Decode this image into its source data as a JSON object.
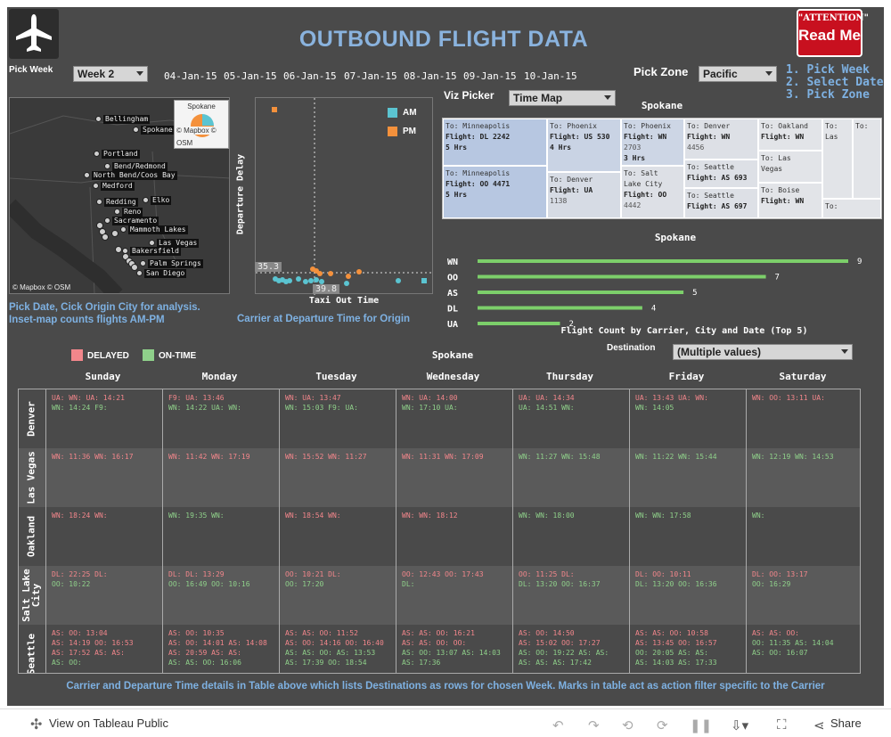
{
  "header": {
    "title": "OUTBOUND FLIGHT DATA",
    "readme_top": "\"ATTENTION\"",
    "readme_main": "Read Me"
  },
  "controls": {
    "pick_week_label": "Pick Week",
    "week_value": "Week 2",
    "dates": [
      "04-Jan-15",
      "05-Jan-15",
      "06-Jan-15",
      "07-Jan-15",
      "08-Jan-15",
      "09-Jan-15",
      "10-Jan-15"
    ],
    "pick_zone_label": "Pick Zone",
    "zone_value": "Pacific",
    "steps": [
      "1. Pick Week",
      "2. Select Date",
      "3. Pick Zone"
    ],
    "viz_picker_label": "Viz Picker",
    "viz_value": "Time Map",
    "destination_label": "Destination",
    "destination_value": "(Multiple values)"
  },
  "map": {
    "cities": [
      "Bellingham",
      "Spokane",
      "Portland",
      "Bend/Redmond",
      "North Bend/Coos Bay",
      "Medford",
      "Redding",
      "Elko",
      "Reno",
      "Sacramento",
      "Mammoth Lakes",
      "Las Vegas",
      "Bakersfield",
      "Palm Springs",
      "San Diego"
    ],
    "copyright": "© Mapbox  © OSM",
    "inset_title": "Spokane",
    "inset_copyright_1": "© Mapbox  ©",
    "inset_copyright_2": "OSM",
    "caption_1": "Pick Date, Cick Origin City for analysis.",
    "caption_2": "Inset-map counts flights  AM-PM"
  },
  "scatter": {
    "legend": [
      {
        "name": "AM",
        "color": "#5bc4d1"
      },
      {
        "name": "PM",
        "color": "#f4913c"
      }
    ],
    "ylabel": "Departure Delay",
    "xlabel": "Taxi Out Time",
    "ref_y": "35.3",
    "ref_x": "39.8",
    "caption": "Carrier at Departure Time for Origin"
  },
  "timemap": {
    "title": "Spokane",
    "cells": [
      {
        "to": "To: Minneapolis",
        "flight": "Flight: DL 2242",
        "dur": "5 Hrs"
      },
      {
        "to": "To: Minneapolis",
        "flight": "Flight: OO 4471",
        "dur": "5 Hrs"
      },
      {
        "to": "To: Phoenix",
        "flight": "Flight: US 530",
        "dur": "4 Hrs"
      },
      {
        "to": "To: Denver",
        "flight": "Flight: UA",
        "extra": "1138"
      },
      {
        "to": "To: Phoenix",
        "flight": "Flight: WN",
        "extra": "2703",
        "dur": "3 Hrs"
      },
      {
        "to": "To: Salt",
        "flight": "Lake City",
        "extra": "Flight: OO",
        "extra2": "4442"
      },
      {
        "to": "To: Denver",
        "flight": "Flight: WN",
        "extra": "4456"
      },
      {
        "to": "To: Seattle",
        "flight": "Flight: AS 693"
      },
      {
        "to": "To: Seattle",
        "flight": "Flight: AS 697"
      },
      {
        "to": "To: Oakland",
        "flight": "Flight: WN"
      },
      {
        "to": "To: Las",
        "flight": "Vegas"
      },
      {
        "to": "To: Boise",
        "flight": "Flight: WN"
      },
      {
        "to": "To:",
        "flight": "Las"
      },
      {
        "to": "To:"
      },
      {
        "to": "To:"
      }
    ]
  },
  "carrier_bar": {
    "title": "Spokane",
    "caption": "Flight Count by Carrier, City and Date (Top 5)"
  },
  "chart_data": {
    "type": "bar",
    "orientation": "horizontal",
    "title": "Spokane",
    "xlabel": "Flight Count by Carrier, City and Date (Top 5)",
    "categories": [
      "WN",
      "OO",
      "AS",
      "DL",
      "UA"
    ],
    "values": [
      9,
      7,
      5,
      4,
      2
    ],
    "color": "#7ccf6a"
  },
  "calendar": {
    "title": "Spokane",
    "legend_delayed": "DELAYED",
    "legend_ontime": "ON-TIME",
    "days": [
      "Sunday",
      "Monday",
      "Tuesday",
      "Wednesday",
      "Thursday",
      "Friday",
      "Saturday"
    ],
    "rows": [
      {
        "city": "Denver",
        "cells": [
          [
            [
              "dl",
              "UA: WN: UA: 14:21"
            ],
            [
              "ot",
              "WN: 14:24 F9:"
            ]
          ],
          [
            [
              "dl",
              "F9: UA: 13:46"
            ],
            [
              "ot",
              "WN: 14:22 UA: WN:"
            ]
          ],
          [
            [
              "dl",
              "WN: UA: 13:47"
            ],
            [
              "ot",
              "WN: 15:03 F9: UA:"
            ]
          ],
          [
            [
              "dl",
              "WN: UA: 14:00"
            ],
            [
              "ot",
              "WN: 17:10 UA:"
            ]
          ],
          [
            [
              "dl",
              "UA: UA: 14:34"
            ],
            [
              "ot",
              "UA: 14:51 WN:"
            ]
          ],
          [
            [
              "dl",
              "UA: 13:43 UA: WN:"
            ],
            [
              "ot",
              "WN: 14:05"
            ]
          ],
          [
            [
              "dl",
              "WN: OO: 13:11 UA:"
            ]
          ]
        ]
      },
      {
        "city": "Las Vegas",
        "cells": [
          [
            [
              "dl",
              "WN: 11:36 WN: 16:17"
            ]
          ],
          [
            [
              "dl",
              "WN: 11:42 WN: 17:19"
            ]
          ],
          [
            [
              "dl",
              "WN: 15:52 WN: 11:27"
            ]
          ],
          [
            [
              "dl",
              "WN: 11:31 WN: 17:09"
            ]
          ],
          [
            [
              "ot",
              "WN: 11:27 WN: 15:48"
            ]
          ],
          [
            [
              "ot",
              "WN: 11:22 WN: 15:44"
            ]
          ],
          [
            [
              "ot",
              "WN: 12:19 WN: 14:53"
            ]
          ]
        ]
      },
      {
        "city": "Oakland",
        "cells": [
          [
            [
              "dl",
              "WN: 18:24 WN:"
            ]
          ],
          [
            [
              "ot",
              "WN: 19:35 WN:"
            ]
          ],
          [
            [
              "dl",
              "WN: 18:54 WN:"
            ]
          ],
          [
            [
              "dl",
              "WN: WN: 18:12"
            ]
          ],
          [
            [
              "ot",
              "WN: WN: 18:00"
            ]
          ],
          [
            [
              "ot",
              "WN: WN: 17:58"
            ]
          ],
          [
            [
              "ot",
              "WN:"
            ]
          ]
        ]
      },
      {
        "city": "Salt Lake City",
        "cells": [
          [
            [
              "dl",
              "DL: 22:25 DL:"
            ],
            [
              "ot",
              "OO: 10:22"
            ]
          ],
          [
            [
              "dl",
              "DL: DL: 13:29"
            ],
            [
              "ot",
              "OO: 16:49 OO: 10:16"
            ]
          ],
          [
            [
              "dl",
              "OO: 10:21 DL:"
            ],
            [
              "ot",
              "OO: 17:20"
            ]
          ],
          [
            [
              "dl",
              "OO: 12:43 OO: 17:43"
            ],
            [
              "ot",
              "DL:"
            ]
          ],
          [
            [
              "dl",
              "OO: 11:25 DL:"
            ],
            [
              "ot",
              "DL: 13:20 OO: 16:37"
            ]
          ],
          [
            [
              "dl",
              "DL: OO: 10:11"
            ],
            [
              "ot",
              "DL: 13:20 OO: 16:36"
            ]
          ],
          [
            [
              "dl",
              "DL: OO: 13:17"
            ],
            [
              "ot",
              "OO: 16:29"
            ]
          ]
        ]
      },
      {
        "city": "Seattle",
        "cells": [
          [
            [
              "dl",
              "AS: OO: 13:04"
            ],
            [
              "dl",
              "AS: 14:19 OO: 16:53"
            ],
            [
              "dl",
              "AS: 17:52 AS: AS:"
            ],
            [
              "ot",
              "AS: OO:"
            ]
          ],
          [
            [
              "dl",
              "AS: OO: 10:35"
            ],
            [
              "dl",
              "AS: OO: 14:01 AS: 14:08"
            ],
            [
              "dl",
              "AS: 20:59 AS: AS:"
            ],
            [
              "ot",
              "AS: AS: OO: 16:06"
            ]
          ],
          [
            [
              "dl",
              "AS: AS: OO: 11:52"
            ],
            [
              "dl",
              "AS: OO: 14:16 OO: 16:40"
            ],
            [
              "ot",
              "AS: AS: OO: AS: 13:53"
            ],
            [
              "ot",
              "AS: 17:39 OO: 18:54"
            ]
          ],
          [
            [
              "dl",
              "AS: AS: OO: 16:21"
            ],
            [
              "dl",
              "AS: AS: OO: OO:"
            ],
            [
              "ot",
              "AS: OO: 13:07 AS: 14:03"
            ],
            [
              "ot",
              "AS: 17:36"
            ]
          ],
          [
            [
              "dl",
              "AS: OO: 14:50"
            ],
            [
              "dl",
              "AS: 15:02 OO: 17:27"
            ],
            [
              "ot",
              "AS: OO: 19:22 AS: AS:"
            ],
            [
              "ot",
              "AS: AS: AS: 17:42"
            ]
          ],
          [
            [
              "dl",
              "AS: AS: OO: 10:58"
            ],
            [
              "dl",
              "AS: 13:45 OO: 16:57"
            ],
            [
              "ot",
              "OO: 20:05 AS: AS:"
            ],
            [
              "ot",
              "AS: 14:03 AS: 17:33"
            ]
          ],
          [
            [
              "dl",
              "AS: AS: OO:"
            ],
            [
              "ot",
              "OO: 11:35 AS: 14:04"
            ],
            [
              "ot",
              "AS: OO: 16:07"
            ]
          ]
        ]
      }
    ]
  },
  "footer_note": "Carrier and Departure Time details in Table above which lists Destinations as rows for chosen Week. Marks in table act as action filter specific to the Carrier",
  "toolbar": {
    "view_label": "View on Tableau Public",
    "share_label": "Share"
  }
}
